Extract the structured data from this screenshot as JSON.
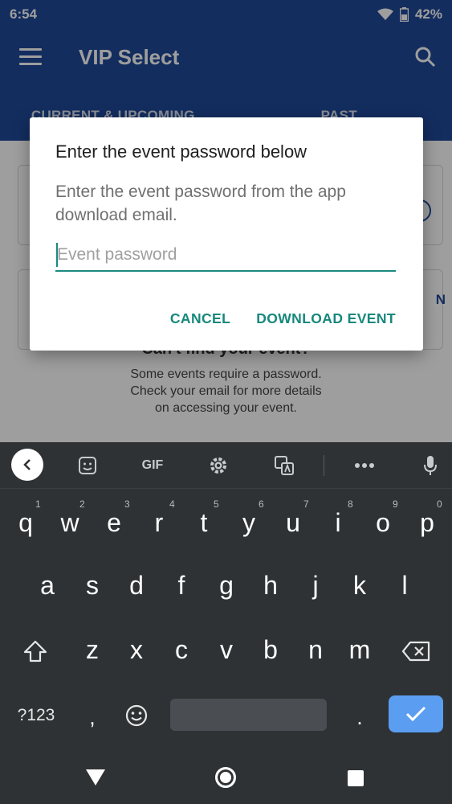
{
  "status_bar": {
    "time": "6:54",
    "battery": "42%"
  },
  "app": {
    "title": "VIP Select",
    "tabs": [
      "CURRENT & UPCOMING",
      "PAST"
    ],
    "empty_state": {
      "title": "Can't find your event?",
      "lines": [
        "Some events require a password.",
        "Check your email for more details",
        "on accessing your event."
      ]
    },
    "card_side_text": "N"
  },
  "dialog": {
    "title": "Enter the event password below",
    "message": "Enter the event password from the app download email.",
    "input": {
      "value": "",
      "placeholder": "Event password"
    },
    "cancel_label": "CANCEL",
    "confirm_label": "DOWNLOAD EVENT"
  },
  "keyboard": {
    "toolbar": {
      "gif_label": "GIF"
    },
    "row1": [
      "q",
      "w",
      "e",
      "r",
      "t",
      "y",
      "u",
      "i",
      "o",
      "p"
    ],
    "row1_hints": [
      "1",
      "2",
      "3",
      "4",
      "5",
      "6",
      "7",
      "8",
      "9",
      "0"
    ],
    "row2": [
      "a",
      "s",
      "d",
      "f",
      "g",
      "h",
      "j",
      "k",
      "l"
    ],
    "row3": [
      "z",
      "x",
      "c",
      "v",
      "b",
      "n",
      "m"
    ],
    "symbols_label": "?123",
    "comma": ",",
    "period": "."
  },
  "colors": {
    "app_bar": "#1f4a9a",
    "accent": "#17887c",
    "keyboard_bg": "#2e3235",
    "enter_key": "#5b9df0"
  }
}
